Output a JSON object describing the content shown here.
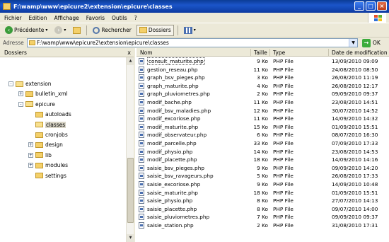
{
  "window": {
    "title": "F:\\wamp\\www\\epicure2\\extension\\epicure\\classes"
  },
  "menu": {
    "items": [
      "Fichier",
      "Edition",
      "Affichage",
      "Favoris",
      "Outils",
      "?"
    ]
  },
  "toolbar": {
    "back": "Précédente",
    "search": "Rechercher",
    "folders": "Dossiers"
  },
  "address": {
    "label": "Adresse",
    "value": "F:\\wamp\\www\\epicure2\\extension\\epicure\\classes",
    "go": "OK"
  },
  "tree": {
    "header": "Dossiers",
    "close": "x",
    "items": [
      {
        "label": "extension",
        "indent": 0,
        "expander": "-",
        "selected": false
      },
      {
        "label": "bulletin_xml",
        "indent": 1,
        "expander": "+",
        "selected": false
      },
      {
        "label": "epicure",
        "indent": 1,
        "expander": "-",
        "selected": false
      },
      {
        "label": "autoloads",
        "indent": 2,
        "expander": "",
        "selected": false
      },
      {
        "label": "classes",
        "indent": 2,
        "expander": "",
        "selected": true
      },
      {
        "label": "cronjobs",
        "indent": 2,
        "expander": "",
        "selected": false
      },
      {
        "label": "design",
        "indent": 2,
        "expander": "+",
        "selected": false
      },
      {
        "label": "lib",
        "indent": 2,
        "expander": "+",
        "selected": false
      },
      {
        "label": "modules",
        "indent": 2,
        "expander": "+",
        "selected": false
      },
      {
        "label": "settings",
        "indent": 2,
        "expander": "",
        "selected": false
      }
    ]
  },
  "files": {
    "columns": {
      "name": "Nom",
      "size": "Taille",
      "type": "Type",
      "date": "Date de modification"
    },
    "rows": [
      {
        "name": "consult_maturite.php",
        "size": "9 Ko",
        "type": "PHP File",
        "date": "13/09/2010 09:09"
      },
      {
        "name": "gestion_reseau.php",
        "size": "11 Ko",
        "type": "PHP File",
        "date": "24/08/2010 08:50"
      },
      {
        "name": "graph_bsv_pieges.php",
        "size": "3 Ko",
        "type": "PHP File",
        "date": "26/08/2010 11:19"
      },
      {
        "name": "graph_maturite.php",
        "size": "4 Ko",
        "type": "PHP File",
        "date": "26/08/2010 12:17"
      },
      {
        "name": "graph_pluviometres.php",
        "size": "2 Ko",
        "type": "PHP File",
        "date": "09/09/2010 09:37"
      },
      {
        "name": "modif_bache.php",
        "size": "11 Ko",
        "type": "PHP File",
        "date": "23/08/2010 14:51"
      },
      {
        "name": "modif_bsv_maladies.php",
        "size": "12 Ko",
        "type": "PHP File",
        "date": "30/07/2010 14:52"
      },
      {
        "name": "modif_excoriose.php",
        "size": "11 Ko",
        "type": "PHP File",
        "date": "14/09/2010 14:32"
      },
      {
        "name": "modif_maturite.php",
        "size": "15 Ko",
        "type": "PHP File",
        "date": "01/09/2010 15:51"
      },
      {
        "name": "modif_observateur.php",
        "size": "6 Ko",
        "type": "PHP File",
        "date": "08/07/2010 16:30"
      },
      {
        "name": "modif_parcelle.php",
        "size": "33 Ko",
        "type": "PHP File",
        "date": "07/09/2010 17:33"
      },
      {
        "name": "modif_physio.php",
        "size": "14 Ko",
        "type": "PHP File",
        "date": "23/08/2010 14:53"
      },
      {
        "name": "modif_placette.php",
        "size": "18 Ko",
        "type": "PHP File",
        "date": "14/09/2010 14:16"
      },
      {
        "name": "saisie_bsv_pieges.php",
        "size": "9 Ko",
        "type": "PHP File",
        "date": "09/09/2010 14:20"
      },
      {
        "name": "saisie_bsv_ravageurs.php",
        "size": "5 Ko",
        "type": "PHP File",
        "date": "26/08/2010 17:33"
      },
      {
        "name": "saisie_excoriose.php",
        "size": "9 Ko",
        "type": "PHP File",
        "date": "14/09/2010 10:48"
      },
      {
        "name": "saisie_maturite.php",
        "size": "18 Ko",
        "type": "PHP File",
        "date": "01/09/2010 15:51"
      },
      {
        "name": "saisie_physio.php",
        "size": "8 Ko",
        "type": "PHP File",
        "date": "27/07/2010 14:13"
      },
      {
        "name": "saisie_placette.php",
        "size": "8 Ko",
        "type": "PHP File",
        "date": "09/07/2010 14:00"
      },
      {
        "name": "saisie_pluviometres.php",
        "size": "7 Ko",
        "type": "PHP File",
        "date": "09/09/2010 09:37"
      },
      {
        "name": "saisie_station.php",
        "size": "2 Ko",
        "type": "PHP File",
        "date": "31/08/2010 17:31"
      }
    ]
  }
}
